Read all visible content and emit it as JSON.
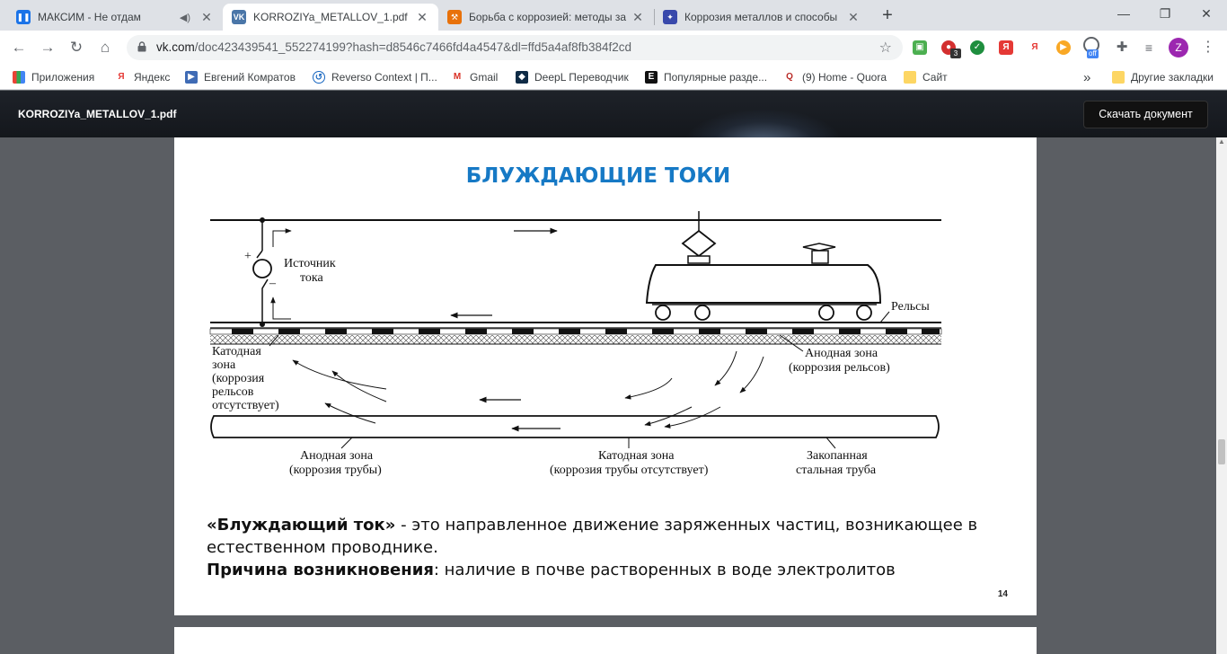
{
  "tabs": [
    {
      "title": "МАКСИМ - Не отдам",
      "favicon": "pause-icon",
      "color": "#1a73e8",
      "active": false
    },
    {
      "title": "KORROZIYa_METALLOV_1.pdf",
      "favicon": "vk-icon",
      "color": "#4a76a8",
      "active": true
    },
    {
      "title": "Борьба с коррозией: методы за",
      "favicon": "hammer-icon",
      "color": "#e8710a",
      "active": false
    },
    {
      "title": "Коррозия металлов и способы",
      "favicon": "compass-icon",
      "color": "#3949ab",
      "active": false
    }
  ],
  "new_tab": "+",
  "window_controls": {
    "minimize": "—",
    "maximize": "❐",
    "close": "✕"
  },
  "toolbar": {
    "url_host": "vk.com",
    "url_rest": "/doc423439541_552274199?hash=d8546c7466fd4a4547&dl=ffd5a4af8fb384f2cd",
    "ext_badge_count": "3",
    "ext_off_label": "off",
    "profile_letter": "Z"
  },
  "bookmarks": [
    {
      "label": "Приложения",
      "icon": "apps-grid-icon"
    },
    {
      "label": "Яндекс",
      "icon": "yandex-icon"
    },
    {
      "label": "Евгений Комратов",
      "icon": "video-icon"
    },
    {
      "label": "Reverso Context | П...",
      "icon": "reverso-icon"
    },
    {
      "label": "Gmail",
      "icon": "gmail-icon"
    },
    {
      "label": "DeepL Переводчик",
      "icon": "deepl-icon"
    },
    {
      "label": "Популярные разде...",
      "icon": "e-icon"
    },
    {
      "label": "(9) Home - Quora",
      "icon": "quora-icon"
    },
    {
      "label": "Сайт",
      "icon": "folder-icon"
    }
  ],
  "bookmarks_overflow": "»",
  "other_bookmarks": "Другие закладки",
  "viewer": {
    "doc_title": "KORROZIYa_METALLOV_1.pdf",
    "download_label": "Скачать документ"
  },
  "slide": {
    "title": "БЛУЖДАЮЩИЕ ТОКИ",
    "diagram": {
      "source_label_1": "Источник",
      "source_label_2": "тока",
      "plus": "+",
      "minus": "–",
      "rails": "Рельсы",
      "cathode_zone_rail": [
        "Катодная",
        "зона",
        "(коррозия",
        "рельсов",
        "отсутствует)"
      ],
      "anode_zone_rail": [
        "Анодная зона",
        "(коррозия рельсов)"
      ],
      "anode_zone_pipe": [
        "Анодная зона",
        "(коррозия трубы)"
      ],
      "cathode_zone_pipe": [
        "Катодная зона",
        "(коррозия трубы отсутствует)"
      ],
      "buried_pipe": [
        "Закопанная",
        "стальная труба"
      ]
    },
    "definition_term": "«Блуждающий ток»",
    "definition_text": " - это направленное движение заряженных частиц, возникающее в естественном проводнике.",
    "cause_term": "Причина возникновения",
    "cause_text": ": наличие в почве растворенных в воде электролитов",
    "page_number": "14"
  }
}
